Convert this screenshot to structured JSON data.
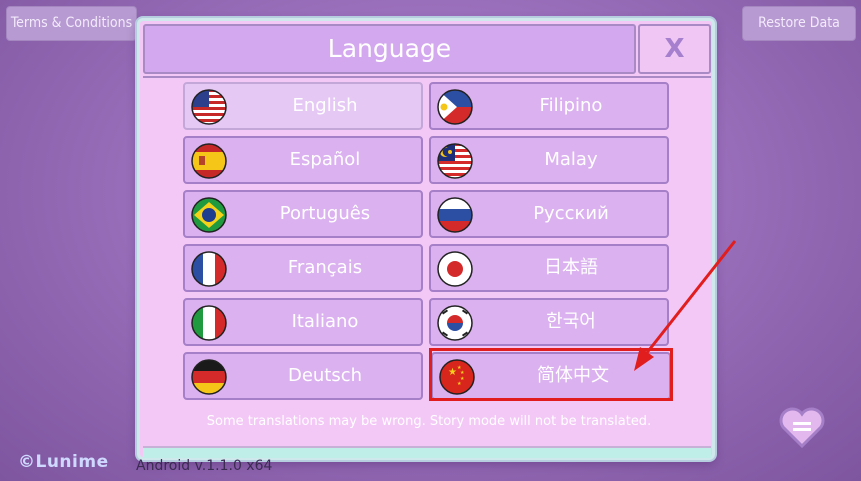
{
  "top_bar": {
    "terms_label": "Terms & Conditions",
    "restore_label": "Restore Data"
  },
  "modal": {
    "title": "Language",
    "close_label": "X",
    "note": "Some translations may be wrong. Story mode will not be translated."
  },
  "languages": {
    "english": "English",
    "espanol": "Español",
    "portugues": "Português",
    "francais": "Français",
    "italiano": "Italiano",
    "deutsch": "Deutsch",
    "filipino": "Filipino",
    "malay": "Malay",
    "russian": "Русский",
    "japanese": "日本語",
    "korean": "한국어",
    "chinese": "简体中文"
  },
  "selected_language": "English",
  "highlighted_language": "简体中文",
  "footer": {
    "logo": "©Lunime",
    "version": "Android v.1.1.0 x64"
  },
  "colors": {
    "annotation_red": "#e11d1d",
    "button_fill": "#dbb2ef",
    "modal_fill": "#f3c8f6"
  }
}
